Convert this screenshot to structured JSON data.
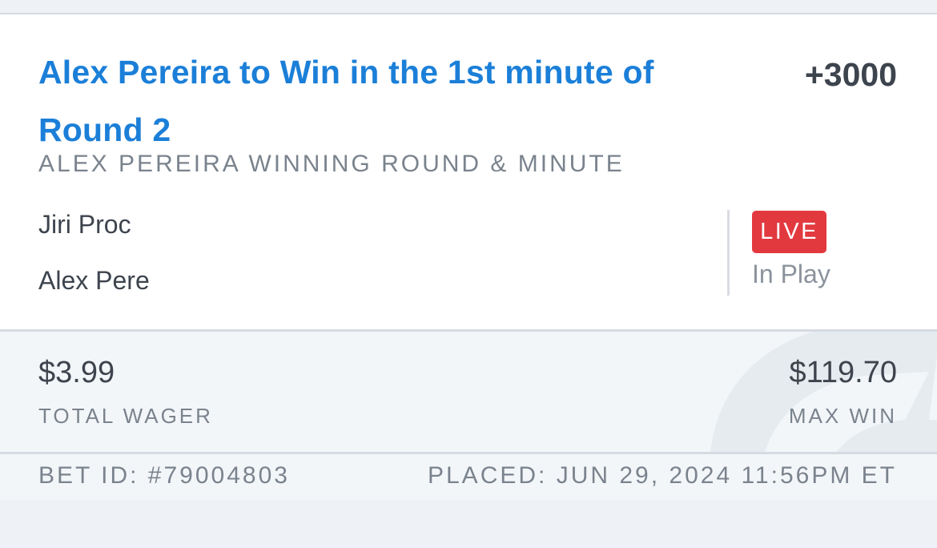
{
  "bet": {
    "title": "Alex Pereira to Win in the 1st minute of Round 2",
    "odds": "+3000",
    "market": "ALEX PEREIRA WINNING ROUND & MINUTE",
    "fighters": [
      "Jiri Proc",
      "Alex Pere"
    ],
    "status": {
      "badge": "LIVE",
      "text": "In Play"
    }
  },
  "summary": {
    "total_wager": "$3.99",
    "total_wager_label": "TOTAL WAGER",
    "max_win": "$119.70",
    "max_win_label": "MAX WIN"
  },
  "footer": {
    "bet_id": "BET ID: #79004803",
    "placed": "PLACED: JUN 29, 2024 11:56PM ET"
  },
  "colors": {
    "title_blue": "#1b7fd8",
    "live_red": "#e2393f",
    "text_dark": "#3d444d",
    "text_muted": "#7a838d",
    "panel_bg": "#f3f6f9"
  },
  "icons": {
    "watermark": "brand-logo-watermark"
  }
}
